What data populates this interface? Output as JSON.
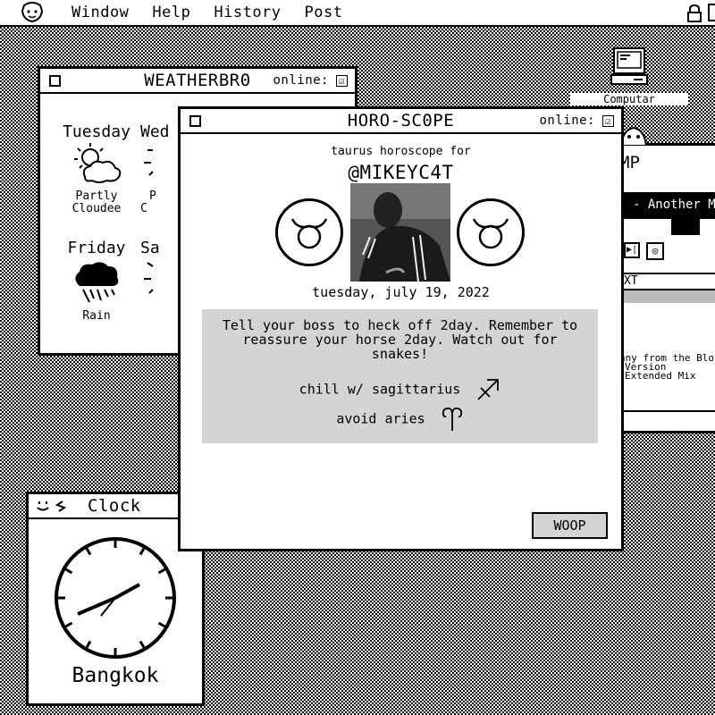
{
  "menubar": {
    "items": [
      "Window",
      "Help",
      "History",
      "Post"
    ]
  },
  "desktop": {
    "computer_icon_label": "Computar"
  },
  "weather": {
    "title": "WEATHERBR0",
    "online_label": "online:",
    "online_checked": "☑",
    "days": [
      {
        "name": "Tuesday",
        "condition": "Partly\nCloudee",
        "icon": "partly-cloudy-icon"
      },
      {
        "name": "Wed",
        "condition": "P\nC",
        "icon": "sun-icon"
      },
      {
        "name": "Friday",
        "condition": "Rain",
        "icon": "rain-icon"
      },
      {
        "name": "Sa",
        "condition": "",
        "icon": "sun-icon"
      }
    ]
  },
  "music": {
    "title": "MP",
    "track": "- Another Man",
    "txt_label": "XT",
    "lines": [
      "nny from the Blo",
      "Version",
      "Extended Mix"
    ]
  },
  "clock": {
    "title": "Clock",
    "city": "Bangkok"
  },
  "horoscope": {
    "title": "HORO-SC0PE",
    "online_label": "online:",
    "online_checked": "☑",
    "subtitle": "taurus horoscope for",
    "handle": "@MIKEYC4T",
    "date": "tuesday, july 19, 2022",
    "message": "Tell your boss to heck off 2day. Remember to reassure your horse 2day. Watch out for snakes!",
    "compat": "chill w/ sagittarius",
    "avoid": "avoid aries",
    "button": "WOOP"
  }
}
